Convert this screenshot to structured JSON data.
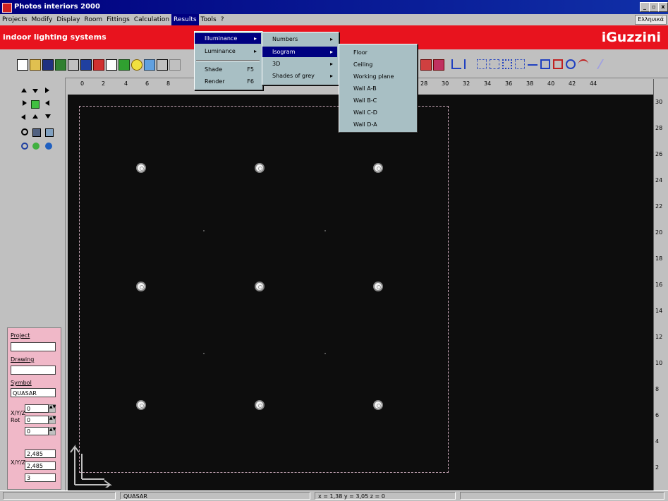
{
  "window": {
    "title": "Photos interiors 2000",
    "controls": [
      "_",
      "▫",
      "x"
    ]
  },
  "menubar": {
    "items": [
      "Projects",
      "Modify",
      "Display",
      "Room",
      "Fittings",
      "Calculation",
      "Results",
      "Tools",
      "?"
    ],
    "active": "Results",
    "language": "Ελληνικά"
  },
  "banner": {
    "tagline": "indoor lighting systems",
    "brand": "iGuzzini"
  },
  "menus": {
    "results": [
      {
        "label": "Illuminance",
        "arrow": "▸",
        "key": ""
      },
      {
        "label": "Luminance",
        "arrow": "▸",
        "key": ""
      },
      {
        "label": "Shade",
        "arrow": "",
        "key": "F5"
      },
      {
        "label": "Render",
        "arrow": "",
        "key": "F6"
      }
    ],
    "illuminance": [
      {
        "label": "Numbers",
        "arrow": "▸"
      },
      {
        "label": "Isogram",
        "arrow": "▸"
      },
      {
        "label": "3D",
        "arrow": "▸"
      },
      {
        "label": "Shades of grey",
        "arrow": "▸"
      }
    ],
    "isogram": [
      "Floor",
      "Ceiling",
      "Working plane",
      "Wall A-B",
      "Wall B-C",
      "Wall C-D",
      "Wall D-A"
    ]
  },
  "ruler_top": [
    "0",
    "2",
    "4",
    "6",
    "8",
    "28",
    "30",
    "32",
    "34",
    "36",
    "38",
    "40",
    "42",
    "44"
  ],
  "ruler_right": [
    "30",
    "28",
    "26",
    "24",
    "22",
    "20",
    "18",
    "16",
    "14",
    "12",
    "10",
    "8",
    "6",
    "4",
    "2"
  ],
  "properties": {
    "project_label": "Project",
    "project_value": "",
    "drawing_label": "Drawing",
    "drawing_value": "",
    "symbol_label": "Symbol",
    "symbol_value": "QUASAR",
    "xyz_rot_label": "X/Y/Z Rot",
    "rot_values": [
      "0",
      "0",
      "0"
    ],
    "xyz_label": "X/Y/Z",
    "xyz_values": [
      "2,485",
      "2,485",
      "3"
    ]
  },
  "statusbar": {
    "symbol": "QUASAR",
    "coords": "x = 1,38  y = 3,05  z = 0"
  },
  "colors": {
    "banner": "#e8131e",
    "titlebar": "#00007e",
    "canvas": "#0d0d0d",
    "menu_bg": "#a8bfc4",
    "property_bg": "#f0b8c8"
  }
}
